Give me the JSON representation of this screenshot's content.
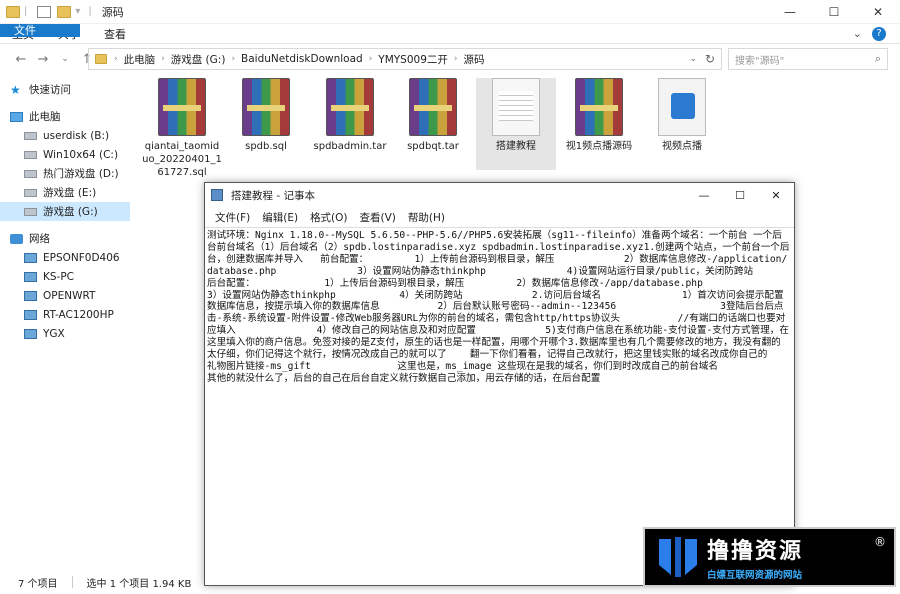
{
  "window": {
    "title": "源码",
    "controls": [
      "—",
      "☐",
      "✕"
    ]
  },
  "ribbon": {
    "tabs": [
      "文件",
      "主页",
      "共享",
      "查看"
    ]
  },
  "address": {
    "crumbs": [
      "此电脑",
      "游戏盘 (G:)",
      "BaiduNetdiskDownload",
      "YMYS009二开",
      "源码"
    ],
    "search_placeholder": "搜索\"源码\""
  },
  "sidebar": {
    "items": [
      {
        "label": "快速访问",
        "level": 0,
        "icon": "star-icon"
      },
      {
        "label": "此电脑",
        "level": 0,
        "icon": "pc-icon"
      },
      {
        "label": "userdisk (B:)",
        "level": 1,
        "icon": "drive-icon"
      },
      {
        "label": "Win10x64 (C:)",
        "level": 1,
        "icon": "drive-icon"
      },
      {
        "label": "热门游戏盘 (D:)",
        "level": 1,
        "icon": "drive-icon"
      },
      {
        "label": "游戏盘 (E:)",
        "level": 1,
        "icon": "drive-icon"
      },
      {
        "label": "游戏盘 (G:)",
        "level": 1,
        "icon": "drive-icon",
        "selected": true
      },
      {
        "label": "网络",
        "level": 0,
        "icon": "network-icon"
      },
      {
        "label": "EPSONF0D406",
        "level": 1,
        "icon": "monitor-icon"
      },
      {
        "label": "KS-PC",
        "level": 1,
        "icon": "monitor-icon"
      },
      {
        "label": "OPENWRT",
        "level": 1,
        "icon": "monitor-icon"
      },
      {
        "label": "RT-AC1200HP",
        "level": 1,
        "icon": "monitor-icon"
      },
      {
        "label": "YGX",
        "level": 1,
        "icon": "monitor-icon"
      }
    ]
  },
  "files": [
    {
      "name": "qiantai_taomiduo_20220401_161727.sql",
      "icon": "archive-icon"
    },
    {
      "name": "spdb.sql",
      "icon": "archive-icon"
    },
    {
      "name": "spdbadmin.tar",
      "icon": "archive-icon"
    },
    {
      "name": "spdbqt.tar",
      "icon": "archive-icon"
    },
    {
      "name": "搭建教程",
      "icon": "text-document-icon",
      "highlighted": true
    },
    {
      "name": "视1频点播源码",
      "icon": "archive-icon"
    },
    {
      "name": "视频点播",
      "icon": "video-file-icon"
    }
  ],
  "notepad": {
    "title": "搭建教程 - 记事本",
    "menu": [
      "文件(F)",
      "编辑(E)",
      "格式(O)",
      "查看(V)",
      "帮助(H)"
    ],
    "content": "测试环境：Nginx 1.18.0--MySQL 5.6.50--PHP-5.6//PHP5.6安装拓展（sg11--fileinfo）准备两个域名：一个前台 一个后台前台域名（1）后台域名（2）spdb.lostinparadise.xyz spdbadmin.lostinparadise.xyz1.创建两个站点，一个前台一个后台，创建数据库并导入   前台配置：        1）上传前台源码到根目录，解压            2）数据库信息修改-/application/database.php              3）设置网站伪静态thinkphp              4)设置网站运行目录/public，关闭防跨站            后台配置：            1）上传后台源码到根目录，解压         2）数据库信息修改-/app/database.php                 3）设置网站伪静态thinkphp           4）关闭防跨站            2.访问后台域名              1）首次访问会提示配置数据库信息，按提示填入你的数据库信息          2）后台默认账号密码--admin--123456                  3登陆后台后点击-系统-系统设置-附件设置-修改Web服务器URL为你的前台的域名，需包含http/https协议头          //有端口的话端口也要对应填入              4）修改自己的网站信息及和对应配置            5)支付商户信息在系统功能-支付设置-支付方式管理，在这里填入你的商户信息。免签对接的是Z支付，原生的话也是一样配置，用哪个开哪个3.数据库里也有几个需要修改的地方，我没有翻的太仔细，你们记得这个就行，按情况改成自己的就可以了    翻一下你们看看，记得自己改就行，把这里钱实账的域名改成你自己的              礼物图片链接-ms_gift               这里也是，ms_image 这些现在是我的域名，你们到时改成自己的前台域名                  其他的就没什么了，后台的自己在后台自定义就行数据自己添加，用云存储的话，在后台配置"
  },
  "status": {
    "count": "7 个项目",
    "selected": "选中 1 个项目  1.94 KB"
  },
  "watermark": {
    "title": "撸撸资源",
    "subtitle": "白嫖互联网资源的网站",
    "mark": "®"
  }
}
